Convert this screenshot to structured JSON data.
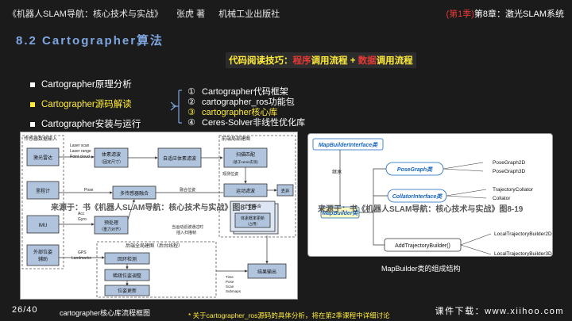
{
  "header": {
    "book_title": "《机器人SLAM导航：核心技术与实战》",
    "author": "张虎 著",
    "publisher": "机械工业出版社",
    "season_prefix": "(第1季)",
    "chapter": "第8章：激光SLAM系统"
  },
  "section_title": "8.2 Cartographer算法",
  "tip": {
    "label": "代码阅读技巧：",
    "part1": "程序",
    "mid": "调用流程 + ",
    "part2": "数据",
    "end": "调用流程"
  },
  "bullets": [
    {
      "label": "Cartographer原理分析",
      "active": false
    },
    {
      "label": "Cartographer源码解读",
      "active": true
    },
    {
      "label": "Cartographer安装与运行",
      "active": false
    }
  ],
  "sublist": [
    {
      "num": "①",
      "label": "Cartographer代码框架",
      "hl": false
    },
    {
      "num": "②",
      "label": "cartographer_ros功能包",
      "hl": false
    },
    {
      "num": "③",
      "label": "cartographer核心库",
      "hl": true
    },
    {
      "num": "④",
      "label": "Ceres-Solver非线性优化库",
      "hl": false
    }
  ],
  "figure1": {
    "caption": "cartographer核心库流程框图",
    "watermark": "来源于：书《机器人SLAM导航：核心技术与实战》图8-18",
    "group_sensors": "传感器数据输入",
    "group_frontend": "前端局部建图",
    "group_backend": "后端全局建图（后台线程）",
    "sensor_labels": [
      "激光雷达",
      "里程计",
      "IMU",
      "外部位姿\n辅助"
    ],
    "lidar_labels": [
      "Laser scan",
      "Laser range",
      "Point cloud"
    ],
    "pose_label": "Pose",
    "imu_labels": [
      "Acc",
      "Gyro"
    ],
    "gps_labels": [
      "GPS",
      "Landmarks"
    ],
    "boxes": {
      "voxel": "体素滤波",
      "voxel_sub": "（固定尺寸）",
      "adaptive": "自适应体素滤波",
      "scan_match": "扫描匹配",
      "scan_match_sub": "（基于ceres实现）",
      "motion_filter": "运动滤波",
      "pose_fuse": "多传感器融合",
      "preprocess": "预处理",
      "preprocess_sub": "（重力对齐）",
      "submap": "子图集合",
      "voxel_update": "体素概率更新",
      "voxel_update_sub": "（占用）",
      "loop": "回环检测",
      "pose_adjust": "稀疏位姿调整",
      "pose_opt": "位姿更新",
      "result": "结果输出",
      "drop": "丢弃"
    },
    "edge_labels": {
      "observe": "观测位姿",
      "fuse_pos": "融合位姿",
      "insert": "当运动滤波通过时\n插入扫描帧"
    },
    "output_labels": [
      "Time",
      "Pose",
      "Scan",
      "Submaps"
    ]
  },
  "figure2": {
    "caption": "MapBuilder类的组成结构",
    "watermark": "来源于：书《机器人SLAM导航：核心技术与实战》图8-19",
    "interface": "MapBuilderInterface类",
    "inherit": "继承",
    "mapbuilder": "MapBuilder类",
    "posegraph": "PoseGraph类",
    "posegraph_children": [
      "PoseGraph2D",
      "PoseGraph3D"
    ],
    "collator": "CollatorInterface类",
    "collator_children": [
      "TrajectoryCollator",
      "Collator"
    ],
    "add_traj": "AddTrajectoryBuilder()",
    "add_traj_children": [
      "LocalTrajectoryBuilder2D",
      "LocalTrajectoryBuilder3D"
    ]
  },
  "footer": {
    "page": "26/40",
    "note": "* 关于cartographer_ros源码的具体分析，将在第2季课程中详细讨论",
    "download": "课件下载：www.xiihoo.com"
  },
  "colors": {
    "background": "#1b1b1b",
    "section_title": "#7ea6e0",
    "highlight": "#ffeb3b",
    "accent_red": "#e53935",
    "class_blue": "#1565c0",
    "class_yellow_bg": "#fff9c4"
  }
}
